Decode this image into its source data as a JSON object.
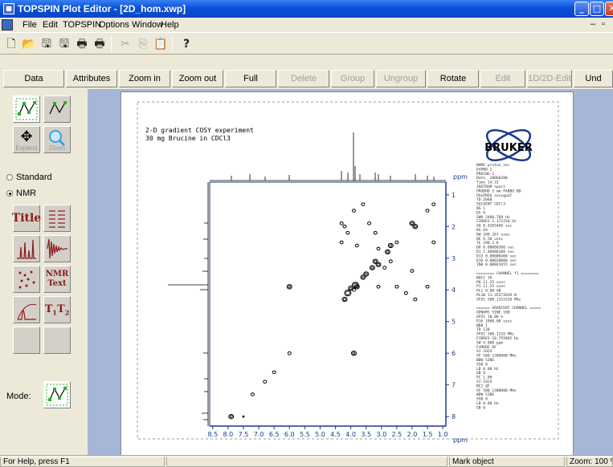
{
  "window": {
    "title": "TOPSPIN Plot Editor - [2D_hom.xwp]"
  },
  "menu": {
    "items": [
      "File",
      "Edit",
      "TOPSPIN",
      "Options",
      "Window",
      "Help"
    ]
  },
  "commands": {
    "data": "Data",
    "attributes": "Attributes",
    "zoom_in": "Zoom in",
    "zoom_out": "Zoom out",
    "full": "Full",
    "delete": "Delete",
    "group": "Group",
    "ungroup": "Ungroup",
    "rotate": "Rotate",
    "edit": "Edit",
    "edit_1d2d": "1D/2D-Edit",
    "undo": "Und"
  },
  "tools": {
    "expand": "Expand",
    "zoom": "Zoom",
    "standard": "Standard",
    "nmr": "NMR",
    "title": "Title",
    "nmr_text": "NMR Text",
    "t1t2": "T1T2",
    "mode": "Mode:"
  },
  "plot": {
    "header_line1": "2-D gradient COSY experiment",
    "header_line2": "30 mg Brucine in CDCl3",
    "logo": "BRUKER",
    "x_unit": "ppm",
    "y_unit": "ppm",
    "x_ticks": [
      "8.5",
      "8.0",
      "7.5",
      "7.0",
      "6.5",
      "6.0",
      "5.5",
      "5.0",
      "4.5",
      "4.0",
      "3.5",
      "3.0",
      "2.5",
      "2.0",
      "1.5",
      "1.0"
    ],
    "y_ticks": [
      "1",
      "2",
      "3",
      "4",
      "5",
      "6",
      "7",
      "8"
    ],
    "params": [
      "NAME       proton_ser",
      "EXPNO              2",
      "PROCNO             1",
      "Date_        20060208",
      "Time            14.33",
      "INSTRUM         spect",
      "PROBHD   5 mm PABBO BB-",
      "PULPROG     cosygpqf",
      "TD               2048",
      "SOLVENT         CDCl3",
      "NS                  1",
      "DS                  8",
      "SWH         2400.768 Hz",
      "FIDRES      1.172250 Hz",
      "AQ         0.4265460 sec",
      "RG                 64",
      "DW            208.267 usec",
      "DE               6.50 usec",
      "TE              298.2 K",
      "D0         0.00000300 sec",
      "D1         1.48688108 sec",
      "D13        0.00000400 sec",
      "D16        0.00020000 sec",
      "IN0        0.00041655 sec",
      "",
      "======== CHANNEL f1 ========",
      "NUC1              1H",
      "P0             11.25 usec",
      "P1             11.25 usec",
      "PL1              0.00 dB",
      "PL1W      11.35372639 W",
      "SFO1      500.1315316 MHz",
      "",
      "====== GRADIENT CHANNEL =====",
      "GPNAM1         SINE.100",
      "GPZ1            10.00 %",
      "P16           1000.00 usec",
      "ND0                 1",
      "TD                128",
      "SFO1        500.1316 MHz",
      "FIDRES      18.755865 Hz",
      "SW              4.800 ppm",
      "FnMODE             QF",
      "SI                1024",
      "SF         500.1300000 MHz",
      "WDW              SINE",
      "SSB                 0",
      "LB               0.00 Hz",
      "GB                  0",
      "PC               1.00",
      "SI               1024",
      "MC2                QF",
      "SF         500.1300000 MHz",
      "WDW              SINE",
      "SSB                 0",
      "LB               0.00 Hz",
      "GB                  0"
    ]
  },
  "status": {
    "help": "For Help, press F1",
    "mode": "Mark object",
    "zoom": "Zoom: 100 %"
  }
}
